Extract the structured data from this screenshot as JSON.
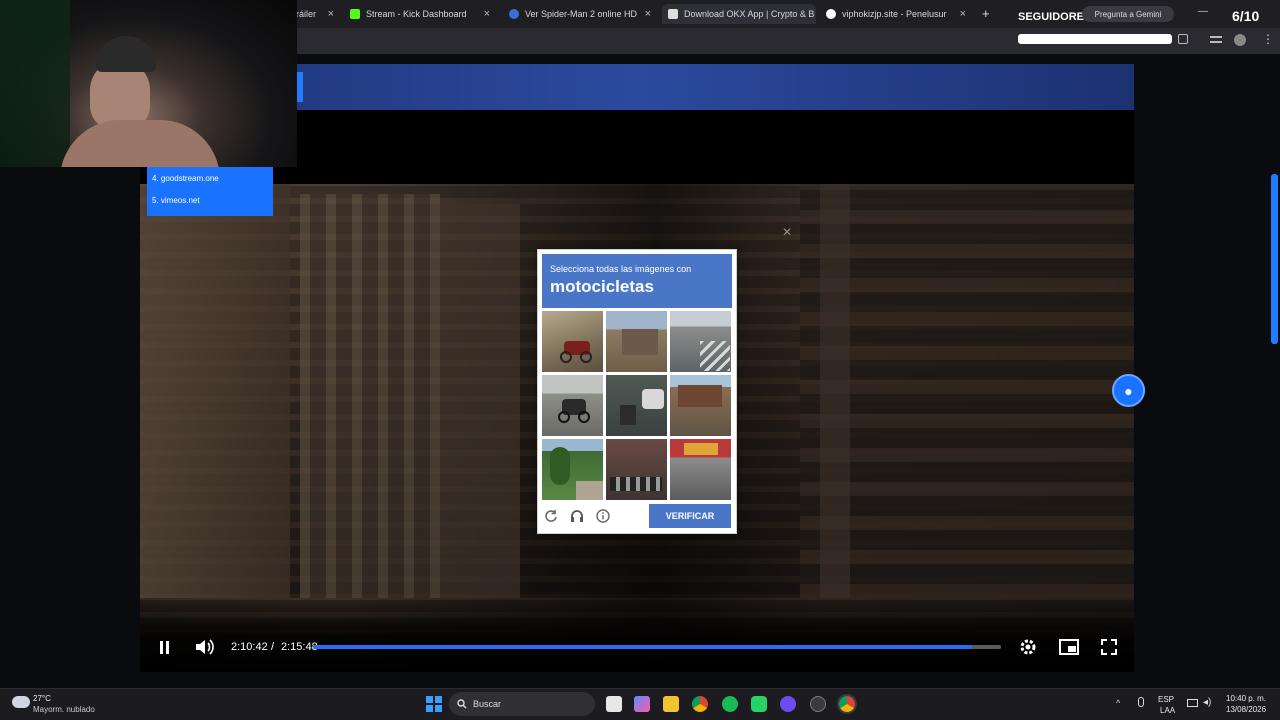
{
  "browser": {
    "tabs": [
      {
        "label": "ráiler",
        "active": false
      },
      {
        "label": "Stream - Kick Dashboard",
        "active": false
      },
      {
        "label": "Ver Spider-Man 2 online HD",
        "active": false
      },
      {
        "label": "Download OKX App | Crypto & B",
        "active": true
      },
      {
        "label": "viphokizjp.site - Penelusur",
        "active": false
      }
    ],
    "new_tab": "+",
    "colors": {
      "tabbar": "#1f1f23",
      "accent": "#1a73ff"
    }
  },
  "overlay": {
    "seguidores": "SEGUIDORES",
    "gemini": "Pregunta a Gemini",
    "counter": "6/10",
    "popup_items": [
      "4. goodstream.one",
      "5. vimeos.net"
    ]
  },
  "captcha": {
    "instruction": "Selecciona todas las imágenes con",
    "target": "motocicletas",
    "verify_label": "VERIFICAR",
    "icons": [
      "reload-icon",
      "headphones-icon",
      "info-icon"
    ],
    "close": "×"
  },
  "player": {
    "current_time": "2:10:42",
    "separator": "/",
    "duration": "2:15:48",
    "progress": 0.958,
    "icons": [
      "pause-icon",
      "volume-icon",
      "settings-icon",
      "pip-icon",
      "fullscreen-icon"
    ]
  },
  "taskbar": {
    "weather_temp": "27°C",
    "weather_desc": "Mayorm. nublado",
    "search_placeholder": "Buscar",
    "lang_top": "ESP",
    "lang_bottom": "LAA",
    "time": "10:40 p. m.",
    "date": "13/08/2026"
  }
}
